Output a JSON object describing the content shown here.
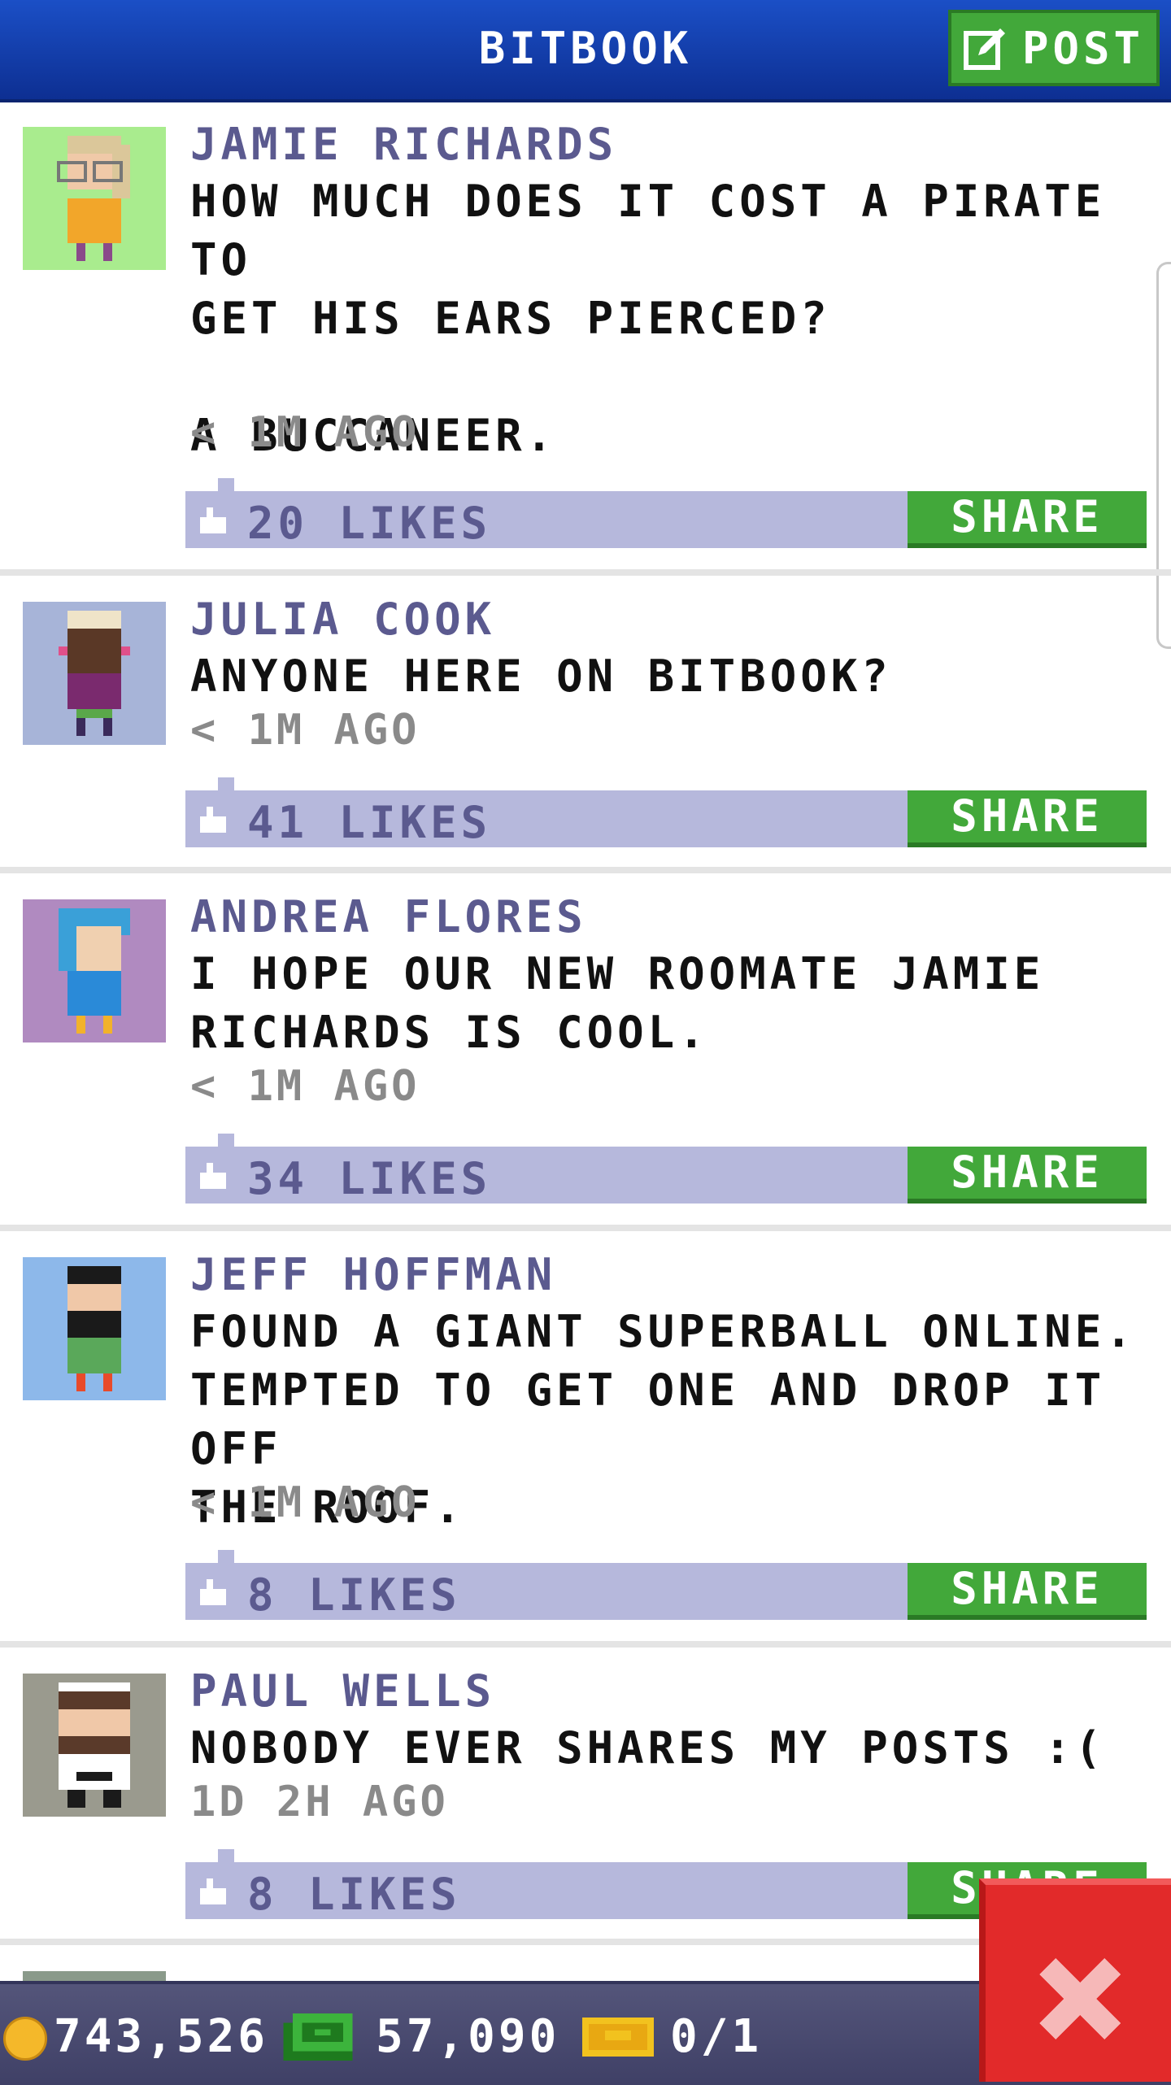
{
  "header": {
    "title": "BITBOOK",
    "post_label": "POST",
    "post_icon": "compose-icon"
  },
  "posts": [
    {
      "author": "JAMIE RICHARDS",
      "message": "HOW MUCH DOES IT COST A PIRATE TO\nGET HIS EARS PIERCED?\n\nA BUCCANEER.",
      "time": "< 1M AGO",
      "likes": "20 LIKES",
      "share": "SHARE"
    },
    {
      "author": "JULIA COOK",
      "message": "ANYONE HERE ON BITBOOK?",
      "time": "< 1M AGO",
      "likes": "41 LIKES",
      "share": "SHARE"
    },
    {
      "author": "ANDREA FLORES",
      "message": "I HOPE OUR NEW ROOMATE JAMIE\nRICHARDS IS COOL.",
      "time": "< 1M AGO",
      "likes": "34 LIKES",
      "share": "SHARE"
    },
    {
      "author": "JEFF HOFFMAN",
      "message": "FOUND A GIANT SUPERBALL ONLINE.\nTEMPTED TO GET ONE AND DROP IT OFF\nTHE ROOF.",
      "time": "< 1M AGO",
      "likes": "8 LIKES",
      "share": "SHARE"
    },
    {
      "author": "PAUL WELLS",
      "message": "NOBODY EVER SHARES MY POSTS :(",
      "time": "1D 2H AGO",
      "likes": "8 LIKES",
      "share": "SHARE"
    }
  ],
  "status_bar": {
    "coins": "743,526",
    "cash": "57,090",
    "tickets": "0/1"
  },
  "colors": {
    "header": "#1b4fc6",
    "accent_green": "#42a83a",
    "author_text": "#5b5a8f",
    "likes_bar": "#b6b8dc",
    "close_red": "#e22a2a"
  }
}
